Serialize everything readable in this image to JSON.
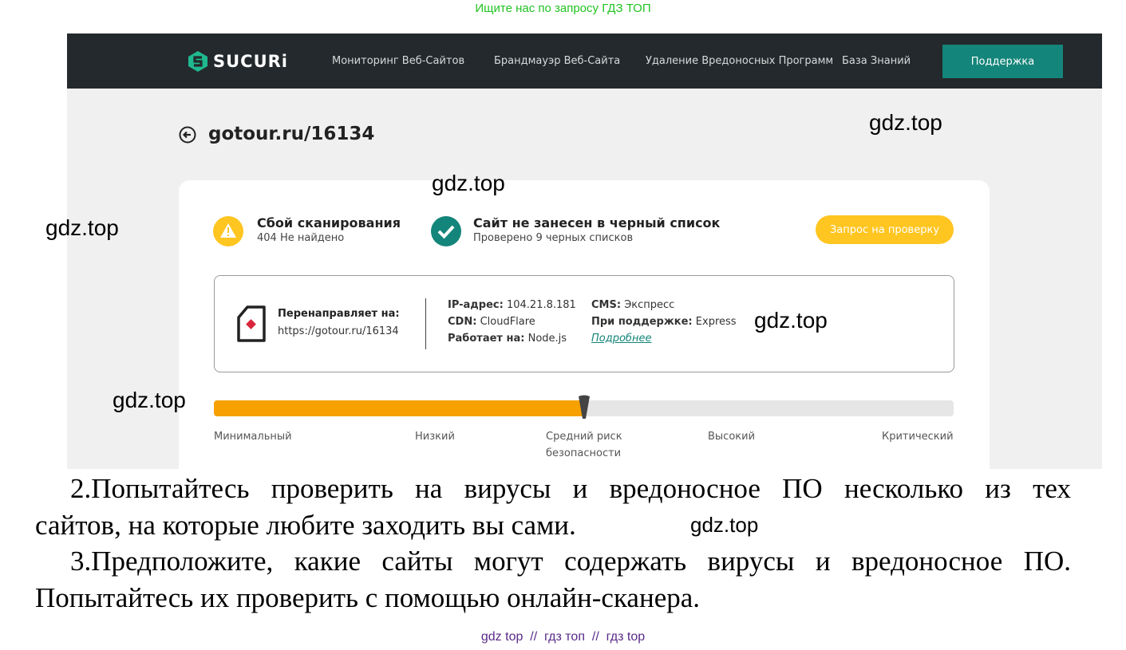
{
  "top_link": "Ищите нас по запросу ГДЗ ТОП",
  "nav": {
    "logo": "SUCURi",
    "items": [
      "Мониторинг Веб-Сайтов",
      "Брандмауэр Веб-Сайта",
      "Удаление Вредоносных Программ",
      "База Знаний"
    ],
    "support": "Поддержка"
  },
  "site": {
    "title": "gotour.ru/16134"
  },
  "status": {
    "scan_title": "Сбой сканирования",
    "scan_sub": "404 Не найдено",
    "black_title": "Сайт не занесен в черный список",
    "black_sub": "Проверено 9 черных списков",
    "request_button": "Запрос на проверку"
  },
  "info": {
    "redirect_label": "Перенаправляет на:",
    "redirect_url": "https://gotour.ru/16134",
    "ip_label": "IP-адрес:",
    "ip_value": "104.21.8.181",
    "cdn_label": "CDN:",
    "cdn_value": "CloudFlare",
    "runs_label": "Работает на:",
    "runs_value": "Node.js",
    "cms_label": "CMS:",
    "cms_value": "Экспресс",
    "powered_label": "При поддержке:",
    "powered_value": "Express",
    "more_link": "Подробнее"
  },
  "risk": {
    "level_fraction": 0.5,
    "labels": [
      "Минимальный",
      "Низкий",
      "Средний риск",
      "безопасности",
      "Высокий",
      "Критический"
    ],
    "colors": {
      "fill": "#f7a100",
      "track": "#e6e6e6"
    }
  },
  "watermark": "gdz.top",
  "text": {
    "item2_line1": "2.Попытайтесь проверить на вирусы и вредоносное ПО несколько из тех",
    "item2_line2": "сайтов, на которые любите заходить вы сами.",
    "item3_line1": "3.Предположите, какие сайты могут содержать вирусы и вредоносное ПО.",
    "item3_line2": "Попытайтесь их проверить с помощью онлайн-сканера."
  },
  "footer": "gdz top  //  гдз топ  //  гдз top"
}
